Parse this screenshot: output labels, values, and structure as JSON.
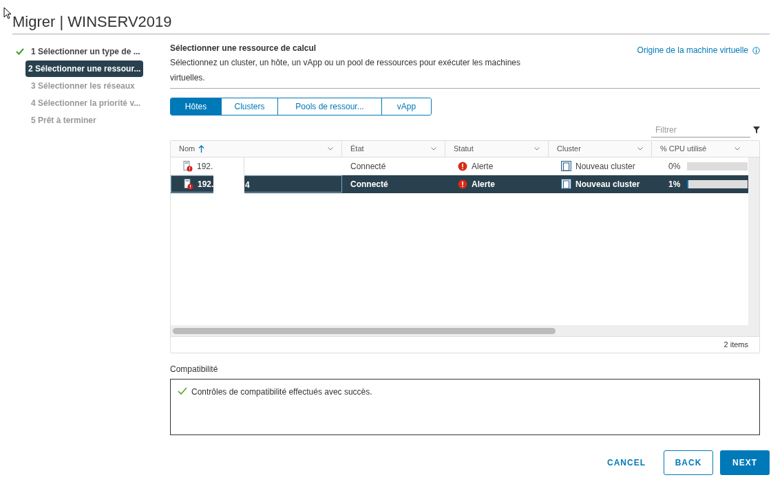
{
  "window": {
    "title": "Migrer | WINSERV2019"
  },
  "steps": [
    {
      "label": "1 Sélectionner un type de ...",
      "done": true,
      "selected": false
    },
    {
      "label": "2 Sélectionner une ressour...",
      "done": false,
      "selected": true
    },
    {
      "label": "3 Sélectionner les réseaux",
      "done": false,
      "selected": false
    },
    {
      "label": "4 Sélectionner la priorité v...",
      "done": false,
      "selected": false
    },
    {
      "label": "5 Prêt à terminer",
      "done": false,
      "selected": false
    }
  ],
  "section": {
    "title": "Sélectionner une ressource de calcul",
    "description": "Sélectionnez un cluster, un hôte, un vApp ou un pool de ressources pour exécuter les machines virtuelles.",
    "link": "Origine de la machine virtuelle"
  },
  "tabs": [
    {
      "label": "Hôtes",
      "selected": true
    },
    {
      "label": "Clusters",
      "selected": false
    },
    {
      "label": "Pools de ressour...",
      "selected": false
    },
    {
      "label": "vApp",
      "selected": false
    }
  ],
  "filter": {
    "placeholder": "Filtrer"
  },
  "table": {
    "columns": [
      "Nom",
      "État",
      "Statut",
      "Cluster",
      "% CPU utilisé"
    ],
    "rows": [
      {
        "name": "192.",
        "name_tail": "",
        "state": "Connecté",
        "status": "Alerte",
        "cluster": "Nouveau cluster",
        "cpu": "0%",
        "level": 0,
        "selected": false
      },
      {
        "name": "192.",
        "name_tail": "4",
        "state": "Connecté",
        "status": "Alerte",
        "cluster": "Nouveau cluster",
        "cpu": "1%",
        "level": 0.01,
        "selected": true
      }
    ],
    "footer": "2 items"
  },
  "compatibility": {
    "label": "Compatibilité",
    "message": "Contrôles de compatibilité effectués avec succès."
  },
  "buttons": [
    {
      "label": "CANCEL",
      "kind": "flat"
    },
    {
      "label": "BACK",
      "kind": "outline"
    },
    {
      "label": "NEXT",
      "kind": "primary"
    }
  ]
}
